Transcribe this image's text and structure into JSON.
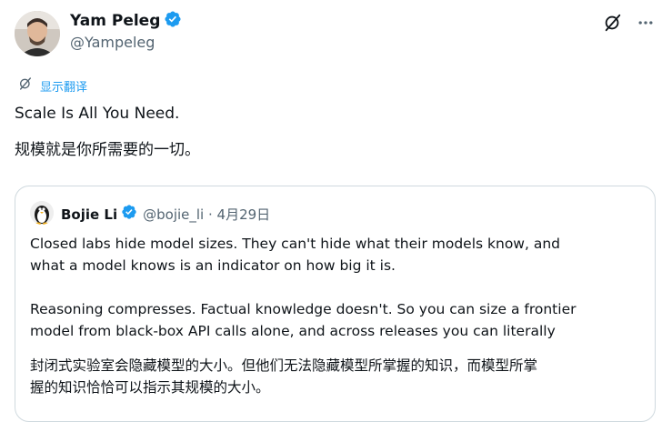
{
  "author": {
    "name": "Yam Peleg",
    "handle": "@Yampeleg"
  },
  "translate_label": "显示翻译",
  "tweet": {
    "line1": "Scale Is All You Need.",
    "line2": "规模就是你所需要的一切。"
  },
  "quoted": {
    "name": "Bojie Li",
    "handle_date": "@bojie_li · 4月29日",
    "lines": [
      "Closed labs hide model sizes. They can't hide what their models know, and",
      "what a model knows is an indicator on how big it is.",
      "",
      "Reasoning compresses. Factual knowledge doesn't. So you can size a frontier",
      "model from black-box API calls alone, and across releases you can literally",
      "",
      "封闭式实验室会隐藏模型的大小。但他们无法隐藏模型所掌握的知识，而模型所掌",
      "握的知识恰恰可以指示其规模的大小。"
    ]
  },
  "colors": {
    "verified": "#1d9bf0",
    "link": "#1d9bf0",
    "secondary_text": "#536471",
    "border": "#cfd9de"
  },
  "icons": [
    "grok-icon",
    "more-icon",
    "translate-icon",
    "verified-badge-icon"
  ]
}
